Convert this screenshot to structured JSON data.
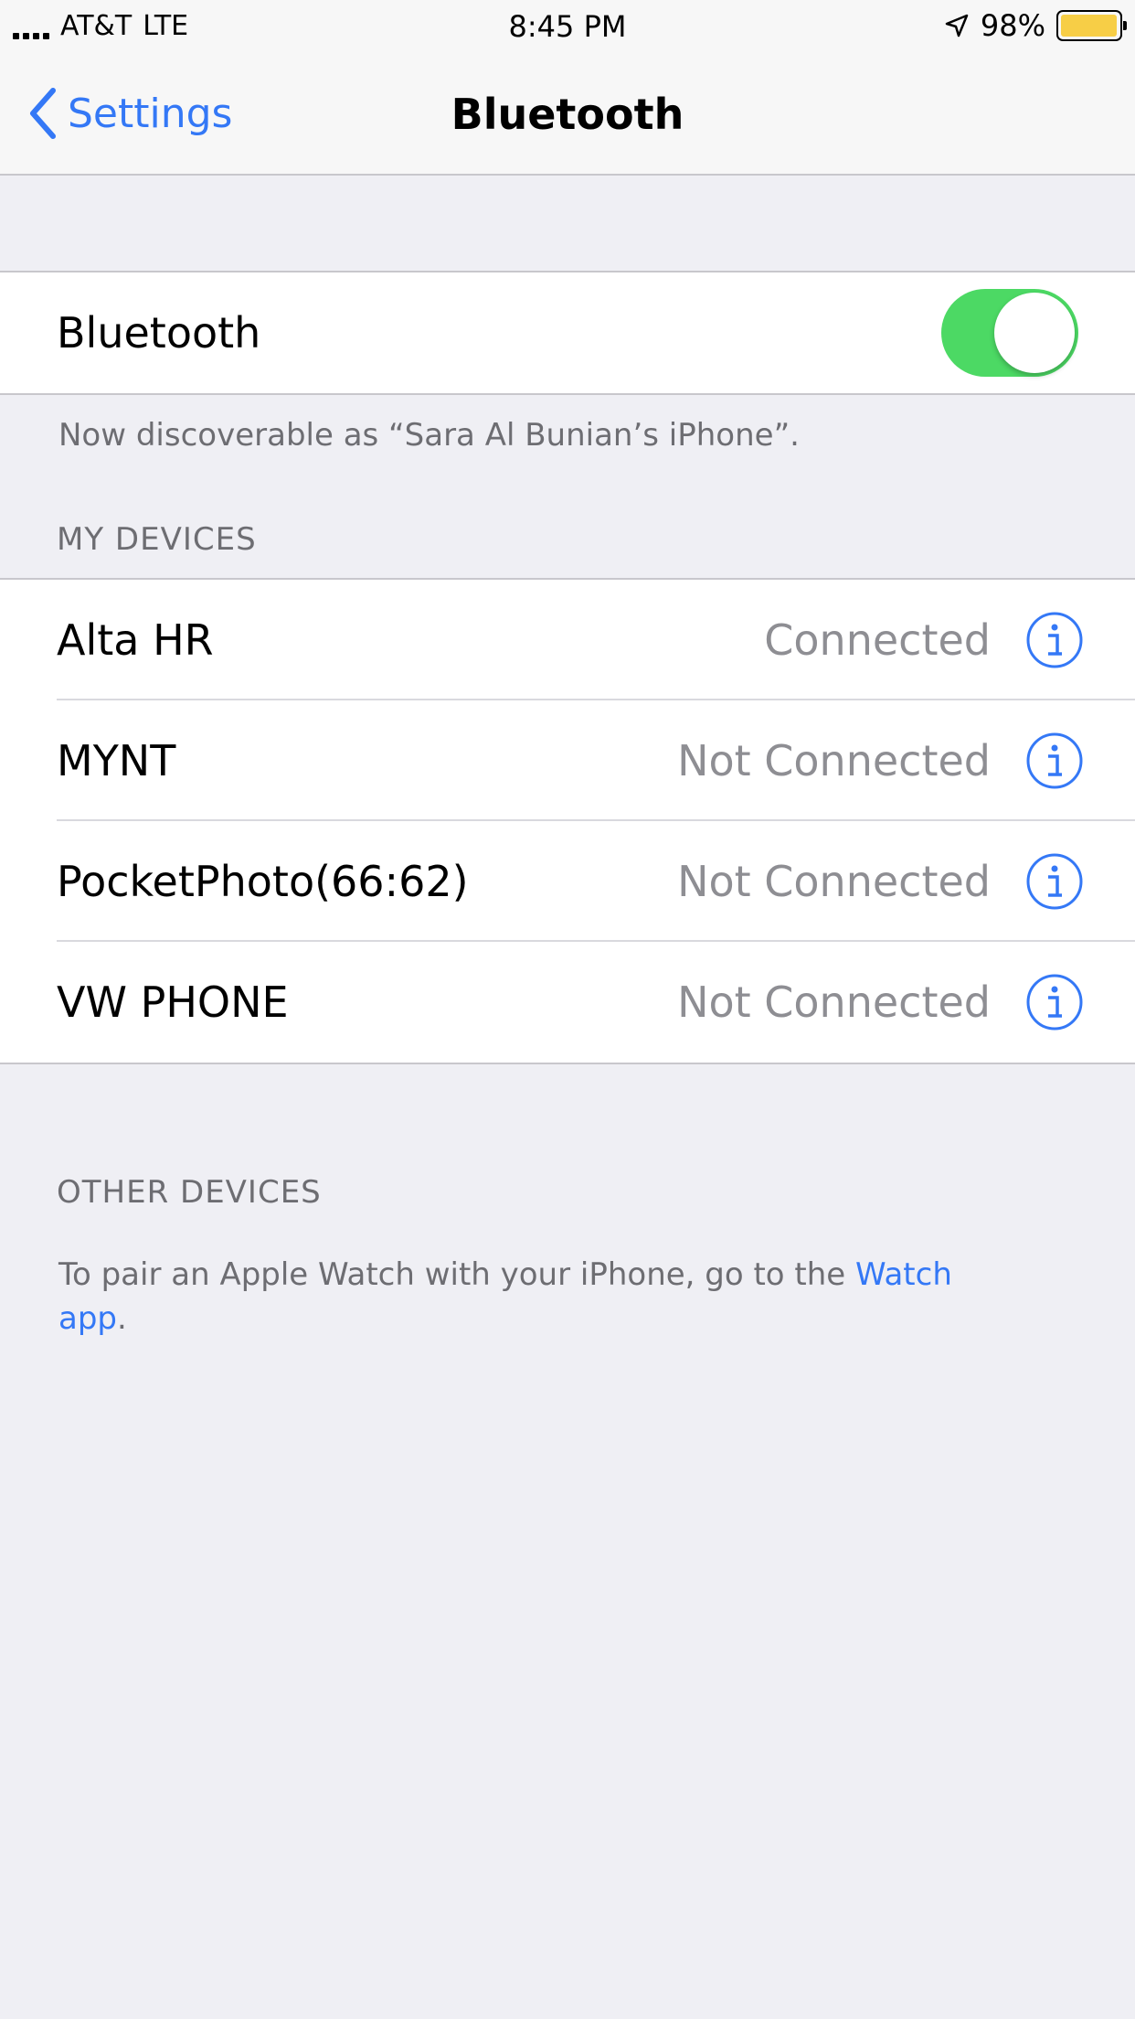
{
  "status_bar": {
    "carrier": "AT&T",
    "network": "LTE",
    "time": "8:45 PM",
    "battery_percent": "98%",
    "battery_level": 0.98,
    "battery_color": "#f7ce46"
  },
  "nav": {
    "back_label": "Settings",
    "title": "Bluetooth",
    "accent": "#3478f6"
  },
  "bluetooth_toggle": {
    "label": "Bluetooth",
    "on": true,
    "on_color": "#4cd964"
  },
  "discoverable_text": "Now discoverable as “Sara Al Bunian’s iPhone”.",
  "my_devices": {
    "header": "MY DEVICES",
    "items": [
      {
        "name": "Alta HR",
        "status": "Connected"
      },
      {
        "name": "MYNT",
        "status": "Not Connected"
      },
      {
        "name": "PocketPhoto(66:62)",
        "status": "Not Connected"
      },
      {
        "name": "VW PHONE",
        "status": "Not Connected"
      }
    ]
  },
  "other_devices": {
    "header": "OTHER DEVICES",
    "text_before_link": "To pair an Apple Watch with your iPhone, go to the ",
    "link_text": "Watch app",
    "text_after_link": "."
  },
  "icons": {
    "back": "chevron-left-icon",
    "info": "info-circle-icon",
    "location": "location-arrow-icon",
    "signal": "signal-bars-icon",
    "battery": "battery-icon"
  }
}
